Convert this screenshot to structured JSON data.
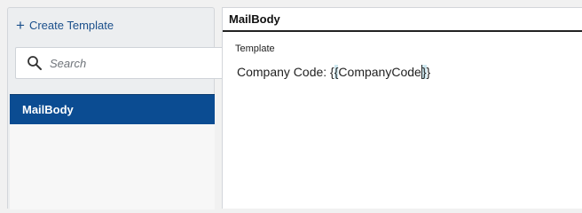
{
  "sidebar": {
    "create_label": "Create Template",
    "search_placeholder": "Search",
    "items": [
      {
        "label": "MailBody",
        "selected": true
      }
    ]
  },
  "main": {
    "title": "MailBody",
    "field_label": "Template",
    "template_prefix": "Company Code: {",
    "template_brace_open_hl": "{",
    "template_var": "CompanyCode",
    "template_brace_close_hl": "}",
    "template_suffix": "}"
  },
  "colors": {
    "accent": "#0b4c92",
    "link": "#1a4f8b"
  },
  "icons": {
    "create": "plus-icon",
    "search": "search-icon"
  }
}
